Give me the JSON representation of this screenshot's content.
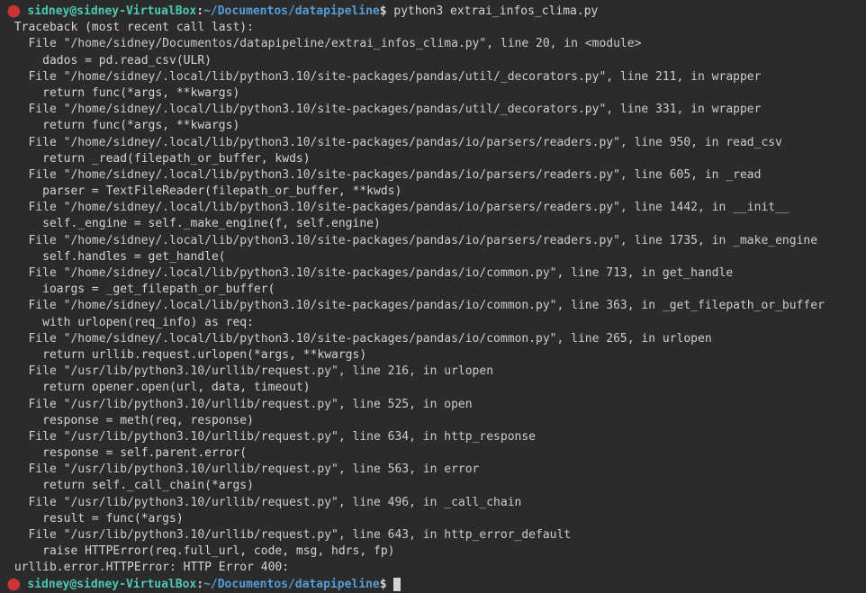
{
  "prompt1": {
    "indicator": "⬤",
    "user_host": "sidney@sidney-VirtualBox",
    "sep": ":",
    "path": "~/Documentos/datapipeline",
    "dollar": "$",
    "command": "python3 extrai_infos_clima.py"
  },
  "traceback_header": " Traceback (most recent call last):",
  "frames": [
    {
      "file": "   File \"/home/sidney/Documentos/datapipeline/extrai_infos_clima.py\", line 20, in <module>",
      "code": "     dados = pd.read_csv(ULR)"
    },
    {
      "file": "   File \"/home/sidney/.local/lib/python3.10/site-packages/pandas/util/_decorators.py\", line 211, in wrapper",
      "code": "     return func(*args, **kwargs)"
    },
    {
      "file": "   File \"/home/sidney/.local/lib/python3.10/site-packages/pandas/util/_decorators.py\", line 331, in wrapper",
      "code": "     return func(*args, **kwargs)"
    },
    {
      "file": "   File \"/home/sidney/.local/lib/python3.10/site-packages/pandas/io/parsers/readers.py\", line 950, in read_csv",
      "code": "     return _read(filepath_or_buffer, kwds)"
    },
    {
      "file": "   File \"/home/sidney/.local/lib/python3.10/site-packages/pandas/io/parsers/readers.py\", line 605, in _read",
      "code": "     parser = TextFileReader(filepath_or_buffer, **kwds)"
    },
    {
      "file": "   File \"/home/sidney/.local/lib/python3.10/site-packages/pandas/io/parsers/readers.py\", line 1442, in __init__",
      "code": "     self._engine = self._make_engine(f, self.engine)"
    },
    {
      "file": "   File \"/home/sidney/.local/lib/python3.10/site-packages/pandas/io/parsers/readers.py\", line 1735, in _make_engine",
      "code": "     self.handles = get_handle("
    },
    {
      "file": "   File \"/home/sidney/.local/lib/python3.10/site-packages/pandas/io/common.py\", line 713, in get_handle",
      "code": "     ioargs = _get_filepath_or_buffer("
    },
    {
      "file": "   File \"/home/sidney/.local/lib/python3.10/site-packages/pandas/io/common.py\", line 363, in _get_filepath_or_buffer",
      "code": "     with urlopen(req_info) as req:"
    },
    {
      "file": "   File \"/home/sidney/.local/lib/python3.10/site-packages/pandas/io/common.py\", line 265, in urlopen",
      "code": "     return urllib.request.urlopen(*args, **kwargs)"
    },
    {
      "file": "   File \"/usr/lib/python3.10/urllib/request.py\", line 216, in urlopen",
      "code": "     return opener.open(url, data, timeout)"
    },
    {
      "file": "   File \"/usr/lib/python3.10/urllib/request.py\", line 525, in open",
      "code": "     response = meth(req, response)"
    },
    {
      "file": "   File \"/usr/lib/python3.10/urllib/request.py\", line 634, in http_response",
      "code": "     response = self.parent.error("
    },
    {
      "file": "   File \"/usr/lib/python3.10/urllib/request.py\", line 563, in error",
      "code": "     return self._call_chain(*args)"
    },
    {
      "file": "   File \"/usr/lib/python3.10/urllib/request.py\", line 496, in _call_chain",
      "code": "     result = func(*args)"
    },
    {
      "file": "   File \"/usr/lib/python3.10/urllib/request.py\", line 643, in http_error_default",
      "code": "     raise HTTPError(req.full_url, code, msg, hdrs, fp)"
    }
  ],
  "error_line": " urllib.error.HTTPError: HTTP Error 400: ",
  "prompt2": {
    "indicator": "⬤",
    "user_host": "sidney@sidney-VirtualBox",
    "sep": ":",
    "path": "~/Documentos/datapipeline",
    "dollar": "$",
    "command": ""
  }
}
